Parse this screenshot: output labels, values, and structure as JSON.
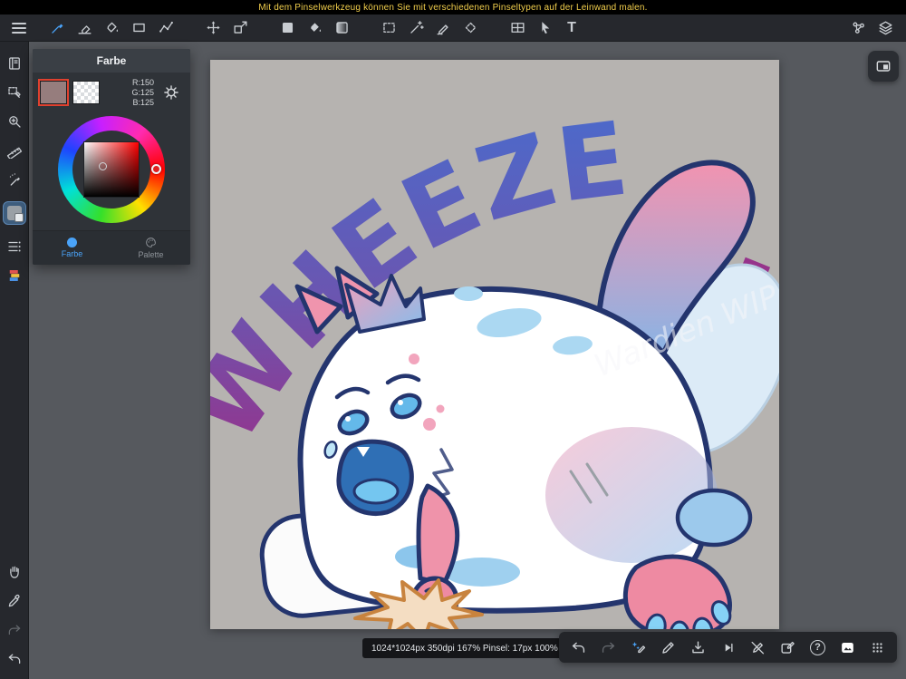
{
  "hint_bar": {
    "text": "Mit dem Pinselwerkzeug können Sie mit verschiedenen Pinseltypen auf der Leinwand malen."
  },
  "toolbar": {
    "text_tool_label": "T"
  },
  "color_panel": {
    "title": "Farbe",
    "rgb_r": "R:150",
    "rgb_g": "G:125",
    "rgb_b": "B:125",
    "tab_color": "Farbe",
    "tab_palette": "Palette",
    "current_color": "#967d7d"
  },
  "canvas": {
    "wheeze_text": "WHEEZE",
    "wheeze_tail_letter": "E",
    "watermark": "Wardien WIP"
  },
  "status_bar": {
    "text": "1024*1024px 350dpi 167%  Pinsel: 17px 100%"
  },
  "bottom_bar": {
    "help_label": "?"
  }
}
